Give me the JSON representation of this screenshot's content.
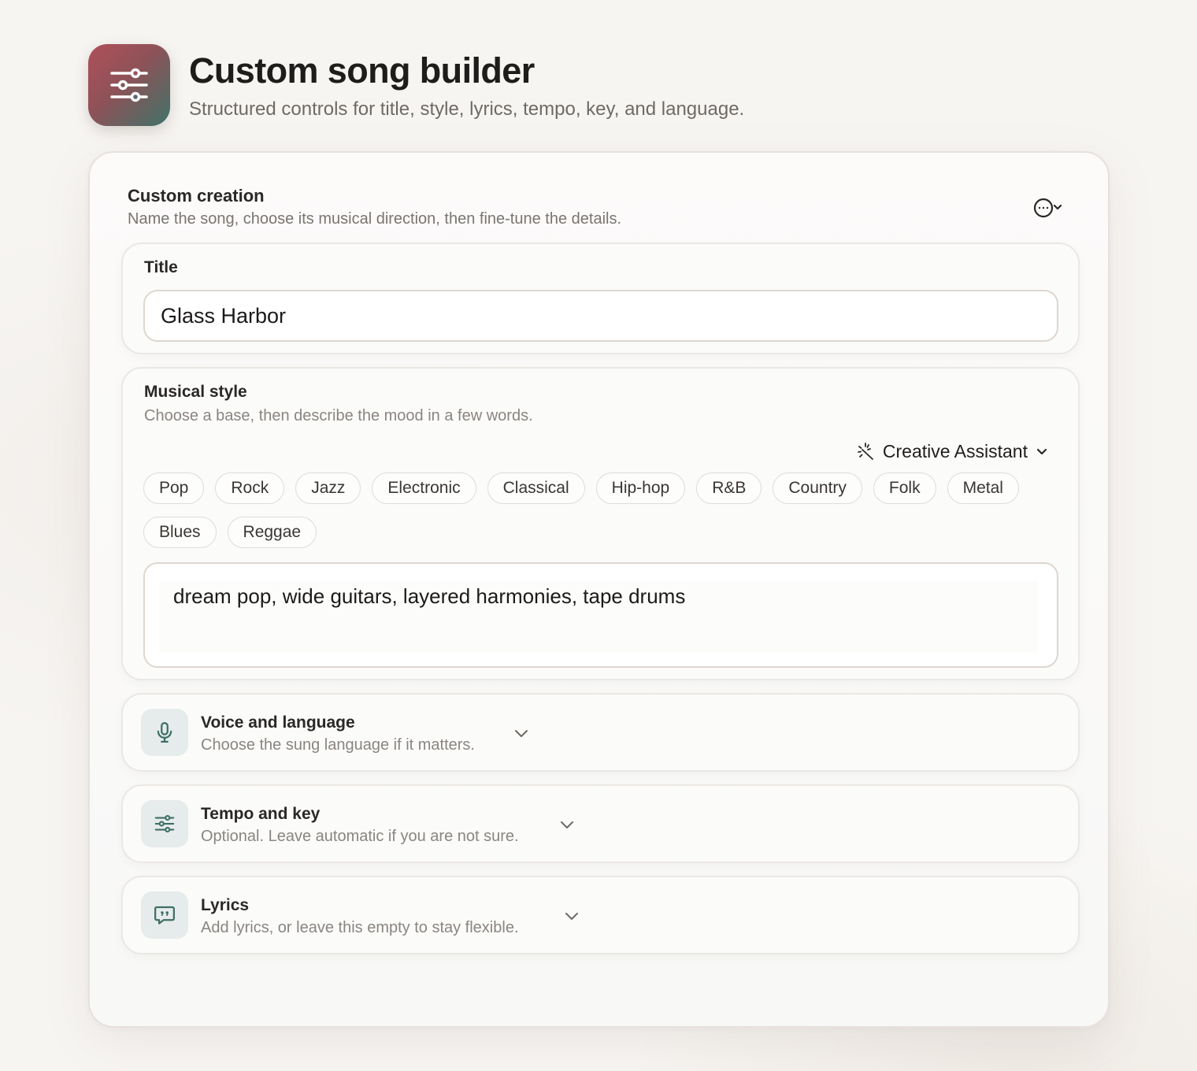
{
  "header": {
    "icon": "sliders-icon",
    "title": "Custom song builder",
    "subtitle": "Structured controls for title, style, lyrics, tempo, key, and language."
  },
  "card": {
    "title": "Custom creation",
    "subtitle": "Name the song, choose its musical direction, then fine-tune the details.",
    "more_icon": "more-options-icon"
  },
  "title_field": {
    "label": "Title",
    "value": "Glass Harbor"
  },
  "style": {
    "label": "Musical style",
    "hint": "Choose a base, then describe the mood in a few words.",
    "assistant_label": "Creative Assistant",
    "genres": [
      "Pop",
      "Rock",
      "Jazz",
      "Electronic",
      "Classical",
      "Hip-hop",
      "R&B",
      "Country",
      "Folk",
      "Metal",
      "Blues",
      "Reggae"
    ],
    "description": "dream pop, wide guitars, layered harmonies, tape drums"
  },
  "sections": [
    {
      "title": "Voice and language",
      "description": "Choose the sung language if it matters.",
      "icon": "microphone-icon"
    },
    {
      "title": "Tempo and key",
      "description": "Optional. Leave automatic if you are not sure.",
      "icon": "sliders-icon"
    },
    {
      "title": "Lyrics",
      "description": "Add lyrics, or leave this empty to stay flexible.",
      "icon": "quote-bubble-icon"
    }
  ],
  "colors": {
    "accent": "#3f6f66",
    "icon_bg": "#e6eceb",
    "brand_gradient_start": "#b0505a",
    "brand_gradient_end": "#3f7369"
  }
}
